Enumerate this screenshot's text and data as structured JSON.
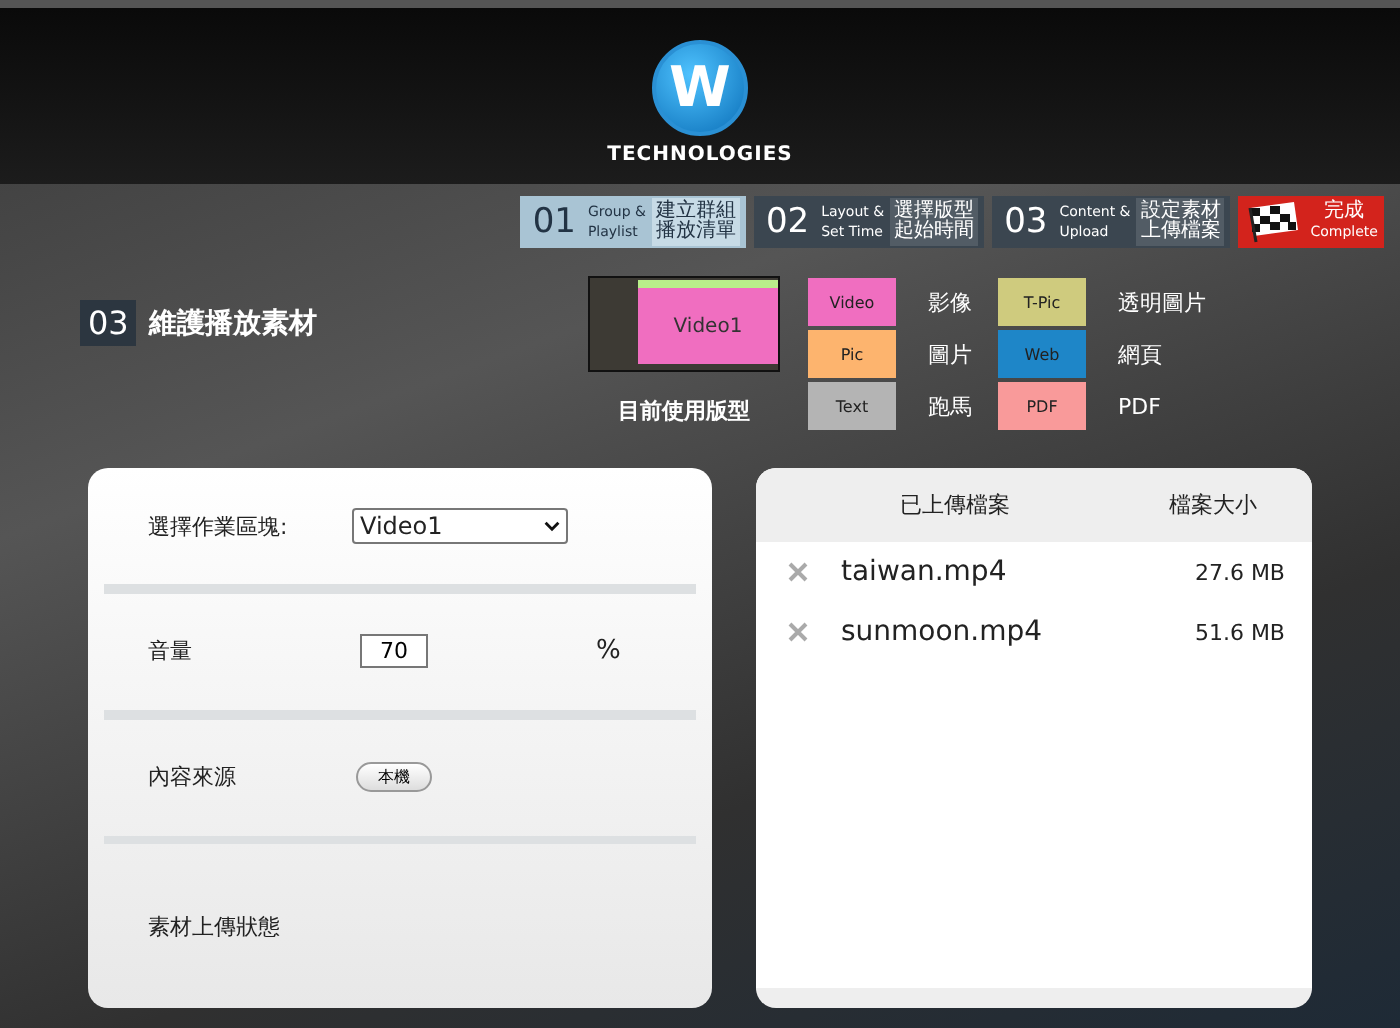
{
  "logo": {
    "letter": "W",
    "brand": "TECHNOLOGIES"
  },
  "steps": [
    {
      "kind": "step",
      "number": "01",
      "en": [
        "Group &",
        "Playlist"
      ],
      "zh": [
        "建立群組",
        "播放清單"
      ],
      "selected": true
    },
    {
      "kind": "step",
      "number": "02",
      "en": [
        "Layout &",
        "Set Time"
      ],
      "zh": [
        "選擇版型",
        "起始時間"
      ],
      "selected": false
    },
    {
      "kind": "step",
      "number": "03",
      "en": [
        "Content &",
        "Upload"
      ],
      "zh": [
        "設定素材",
        "上傳檔案"
      ],
      "selected": false
    },
    {
      "kind": "finish",
      "zh": [
        "完成"
      ],
      "en": [
        "Complete"
      ],
      "selected": false
    }
  ],
  "section": {
    "number": "03",
    "title": "維護播放素材"
  },
  "layout_preview": {
    "region": "Video1",
    "caption": "目前使用版型"
  },
  "legend": [
    {
      "swatch": "Video",
      "name": "影像",
      "color": "#f06ec0"
    },
    {
      "swatch": "Pic",
      "name": "圖片",
      "color": "#fdb46e"
    },
    {
      "swatch": "Text",
      "name": "跑馬",
      "color": "#b4b4b4"
    },
    {
      "swatch": "T-Pic",
      "name": "透明圖片",
      "color": "#cfcb7e"
    },
    {
      "swatch": "Web",
      "name": "網頁",
      "color": "#1e86c8"
    },
    {
      "swatch": "PDF",
      "name": "PDF",
      "color": "#f99a9a"
    }
  ],
  "settings": [
    {
      "kind": "select",
      "label": "選擇作業區塊:",
      "value": "Video1"
    },
    {
      "kind": "number",
      "label": "音量",
      "value": "70",
      "unit": "%"
    },
    {
      "kind": "source",
      "label": "內容來源",
      "button": "本機"
    },
    {
      "kind": "status",
      "label": "素材上傳狀態"
    }
  ],
  "files": {
    "columns": [
      "已上傳檔案",
      "檔案大小"
    ],
    "rows": [
      {
        "name": "taiwan.mp4",
        "size": "27.6 MB"
      },
      {
        "name": "sunmoon.mp4",
        "size": "51.6 MB"
      }
    ]
  }
}
